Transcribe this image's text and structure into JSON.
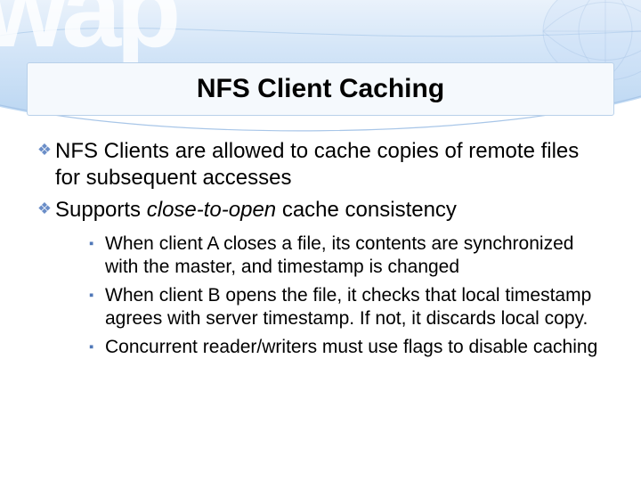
{
  "slide": {
    "watermark": "wap",
    "title": "NFS Client Caching",
    "bullets_level1": [
      {
        "text": "NFS Clients are allowed to cache copies of remote files for subsequent accesses"
      },
      {
        "prefix": "Supports ",
        "italic": "close-to-open",
        "suffix": " cache consistency"
      }
    ],
    "bullets_level2": [
      "When client A closes a file, its contents are synchronized with the master, and timestamp is changed",
      "When client B opens the file, it checks that local timestamp agrees with server timestamp. If not, it discards local copy.",
      "Concurrent reader/writers must use flags to disable caching"
    ]
  }
}
